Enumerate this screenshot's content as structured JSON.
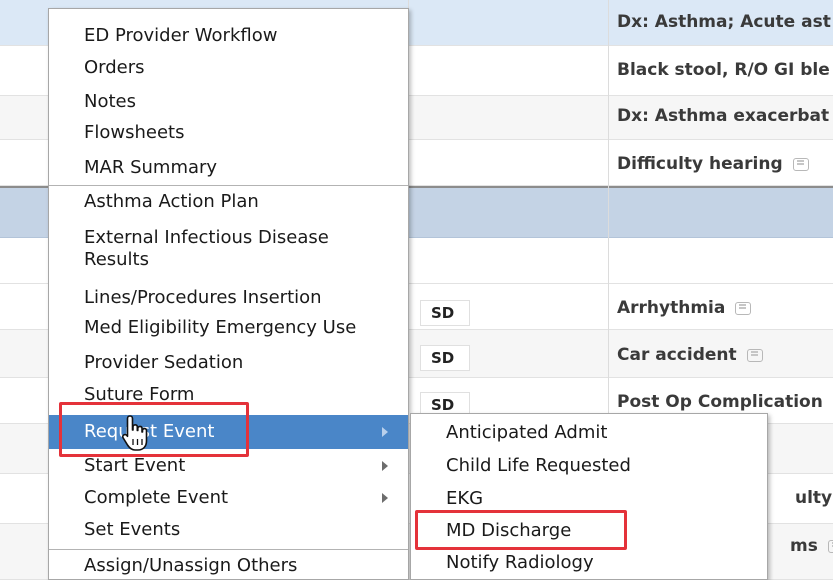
{
  "background": {
    "rows": [
      {
        "dx": "Dx: Asthma; Acute ast",
        "comment": false,
        "sd": ""
      },
      {
        "dx": "Black stool, R/O GI ble",
        "comment": false,
        "sd": ""
      },
      {
        "dx": "Dx: Asthma exacerbat",
        "comment": false,
        "sd": ""
      },
      {
        "dx": "Difficulty hearing",
        "comment": true,
        "sd": ""
      },
      {
        "dx": "",
        "comment": false,
        "sd": ""
      },
      {
        "dx": "",
        "comment": false,
        "sd": ""
      },
      {
        "dx": "Arrhythmia",
        "comment": true,
        "sd": "SD"
      },
      {
        "dx": "Car accident",
        "comment": true,
        "sd": "SD"
      },
      {
        "dx": "Post Op Complication",
        "comment": false,
        "sd": "SD"
      },
      {
        "dx": "",
        "comment": false,
        "sd": ""
      },
      {
        "dx": "ulty",
        "comment": true,
        "sd": ""
      },
      {
        "dx": "ms",
        "comment": true,
        "sd": ""
      }
    ],
    "chip_colors": [
      "#2ebd3b",
      "#7b6fd0"
    ]
  },
  "menu": {
    "items": [
      {
        "label": "ED Provider Workflow",
        "submenu": false
      },
      {
        "label": "Orders",
        "submenu": false
      },
      {
        "label": "Notes",
        "submenu": false
      },
      {
        "label": "Flowsheets",
        "submenu": false
      },
      {
        "label": "MAR Summary",
        "submenu": false
      },
      {
        "label": "Asthma Action Plan",
        "submenu": false
      },
      {
        "label": "External Infectious Disease Results",
        "submenu": false
      },
      {
        "label": "Lines/Procedures Insertion",
        "submenu": false
      },
      {
        "label": "Med Eligibility Emergency Use",
        "submenu": false
      },
      {
        "label": "Provider Sedation",
        "submenu": false
      },
      {
        "label": "Suture Form",
        "submenu": false
      },
      {
        "label": "Request Event",
        "submenu": true,
        "selected": true
      },
      {
        "label": "Start Event",
        "submenu": true
      },
      {
        "label": "Complete Event",
        "submenu": true
      },
      {
        "label": "Set Events",
        "submenu": false
      },
      {
        "label": "Assign/Unassign Others",
        "submenu": false
      }
    ],
    "selected_color": "#4a86c8"
  },
  "submenu": {
    "items": [
      {
        "label": "Anticipated Admit"
      },
      {
        "label": "Child Life Requested"
      },
      {
        "label": "EKG"
      },
      {
        "label": "MD Discharge"
      },
      {
        "label": "Notify Radiology"
      }
    ]
  },
  "highlight_color": "#e4323a",
  "icons": {
    "comment": "comment-icon",
    "submenu_arrow": "chevron-right-icon",
    "cursor": "hand-pointer-icon"
  }
}
